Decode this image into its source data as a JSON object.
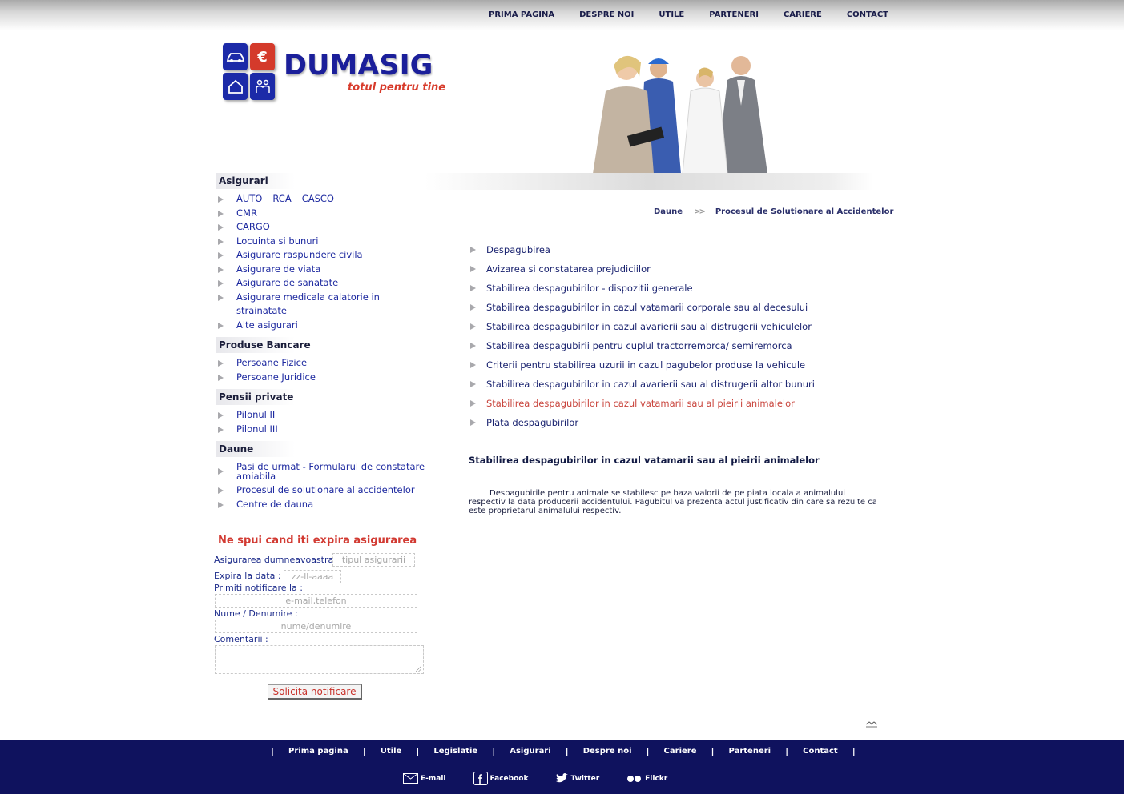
{
  "topnav": [
    "PRIMA PAGINA",
    "DESPRE NOI",
    "UTILE",
    "PARTENERI",
    "CARIERE",
    "CONTACT"
  ],
  "logo": {
    "name": "DUMASIG",
    "tagline": "totul pentru tine",
    "euro_glyph": "€"
  },
  "colors": {
    "brand_blue": "#1b1f9a",
    "accent_red": "#d23a32",
    "footer_bg": "#0f125e",
    "link_blue": "#1e2aa0"
  },
  "sidebar": {
    "asigurari": {
      "title": "Asigurari",
      "auto_row": [
        "AUTO",
        "RCA",
        "CASCO"
      ],
      "items": [
        "CMR",
        "CARGO",
        "Locuinta si bunuri",
        "Asigurare raspundere civila",
        "Asigurare de viata",
        "Asigurare de sanatate",
        "Asigurare medicala calatorie in strainatate",
        "Alte asigurari"
      ]
    },
    "bancare": {
      "title": "Produse Bancare",
      "items": [
        "Persoane Fizice",
        "Persoane Juridice"
      ]
    },
    "pensii": {
      "title": "Pensii private",
      "items": [
        "Pilonul II",
        "Pilonul III"
      ]
    },
    "daune": {
      "title": "Daune",
      "items": [
        "Pasi de urmat - Formularul de constatare amiabila",
        "Procesul de solutionare al accidentelor",
        "Centre de dauna"
      ]
    }
  },
  "notify": {
    "title": "Ne spui cand iti expira asigurarea",
    "label_insurance": "Asigurarea dumneavoastra",
    "placeholder_insurance": "tipul asigurarii",
    "label_date": "Expira la data :",
    "placeholder_date": "zz-ll-aaaa",
    "label_notify": "Primiti notificare la :",
    "placeholder_notify": "e-mail,telefon",
    "label_name": "Nume / Denumire :",
    "placeholder_name": "nume/denumire",
    "label_comments": "Comentarii :",
    "submit": "Solicita notificare"
  },
  "breadcrumb": {
    "root": "Daune",
    "separator": ">>",
    "current": "Procesul de Solutionare al Accidentelor"
  },
  "main": {
    "items": [
      "Despagubirea",
      "Avizarea si constatarea prejudiciilor",
      "Stabilirea despagubirilor - dispozitii generale",
      "Stabilirea despagubirilor in cazul vatamarii corporale sau al decesului",
      "Stabilirea despagubirilor in cazul avarierii sau al distrugerii vehiculelor",
      "Stabilirea despagubirii pentru cuplul tractorremorca/ semiremorca",
      "Criterii pentru stabilirea uzurii in cazul pagubelor produse la vehicule",
      "Stabilirea despagubirilor in cazul avarierii sau al distrugerii altor bunuri",
      "Stabilirea despagubirilor in cazul vatamarii sau al pieirii animalelor",
      "Plata despagubirilor"
    ],
    "active_index": 8,
    "title": "Stabilirea despagubirilor in cazul vatamarii sau al pieirii animalelor",
    "text": "Despagubirile pentru animale se stabilesc pe baza valorii de pe piata locala a animalului respectiv la data producerii accidentului. Pagubitul va prezenta actul justificativ din care sa rezulte ca este proprietarul animalului respectiv."
  },
  "footer": {
    "nav": [
      "Prima pagina",
      "Utile",
      "Legislatie",
      "Asigurari",
      "Despre noi",
      "Cariere",
      "Parteneri",
      "Contact"
    ],
    "social": [
      "E-mail",
      "Facebook",
      "Twitter",
      "Flickr"
    ]
  }
}
